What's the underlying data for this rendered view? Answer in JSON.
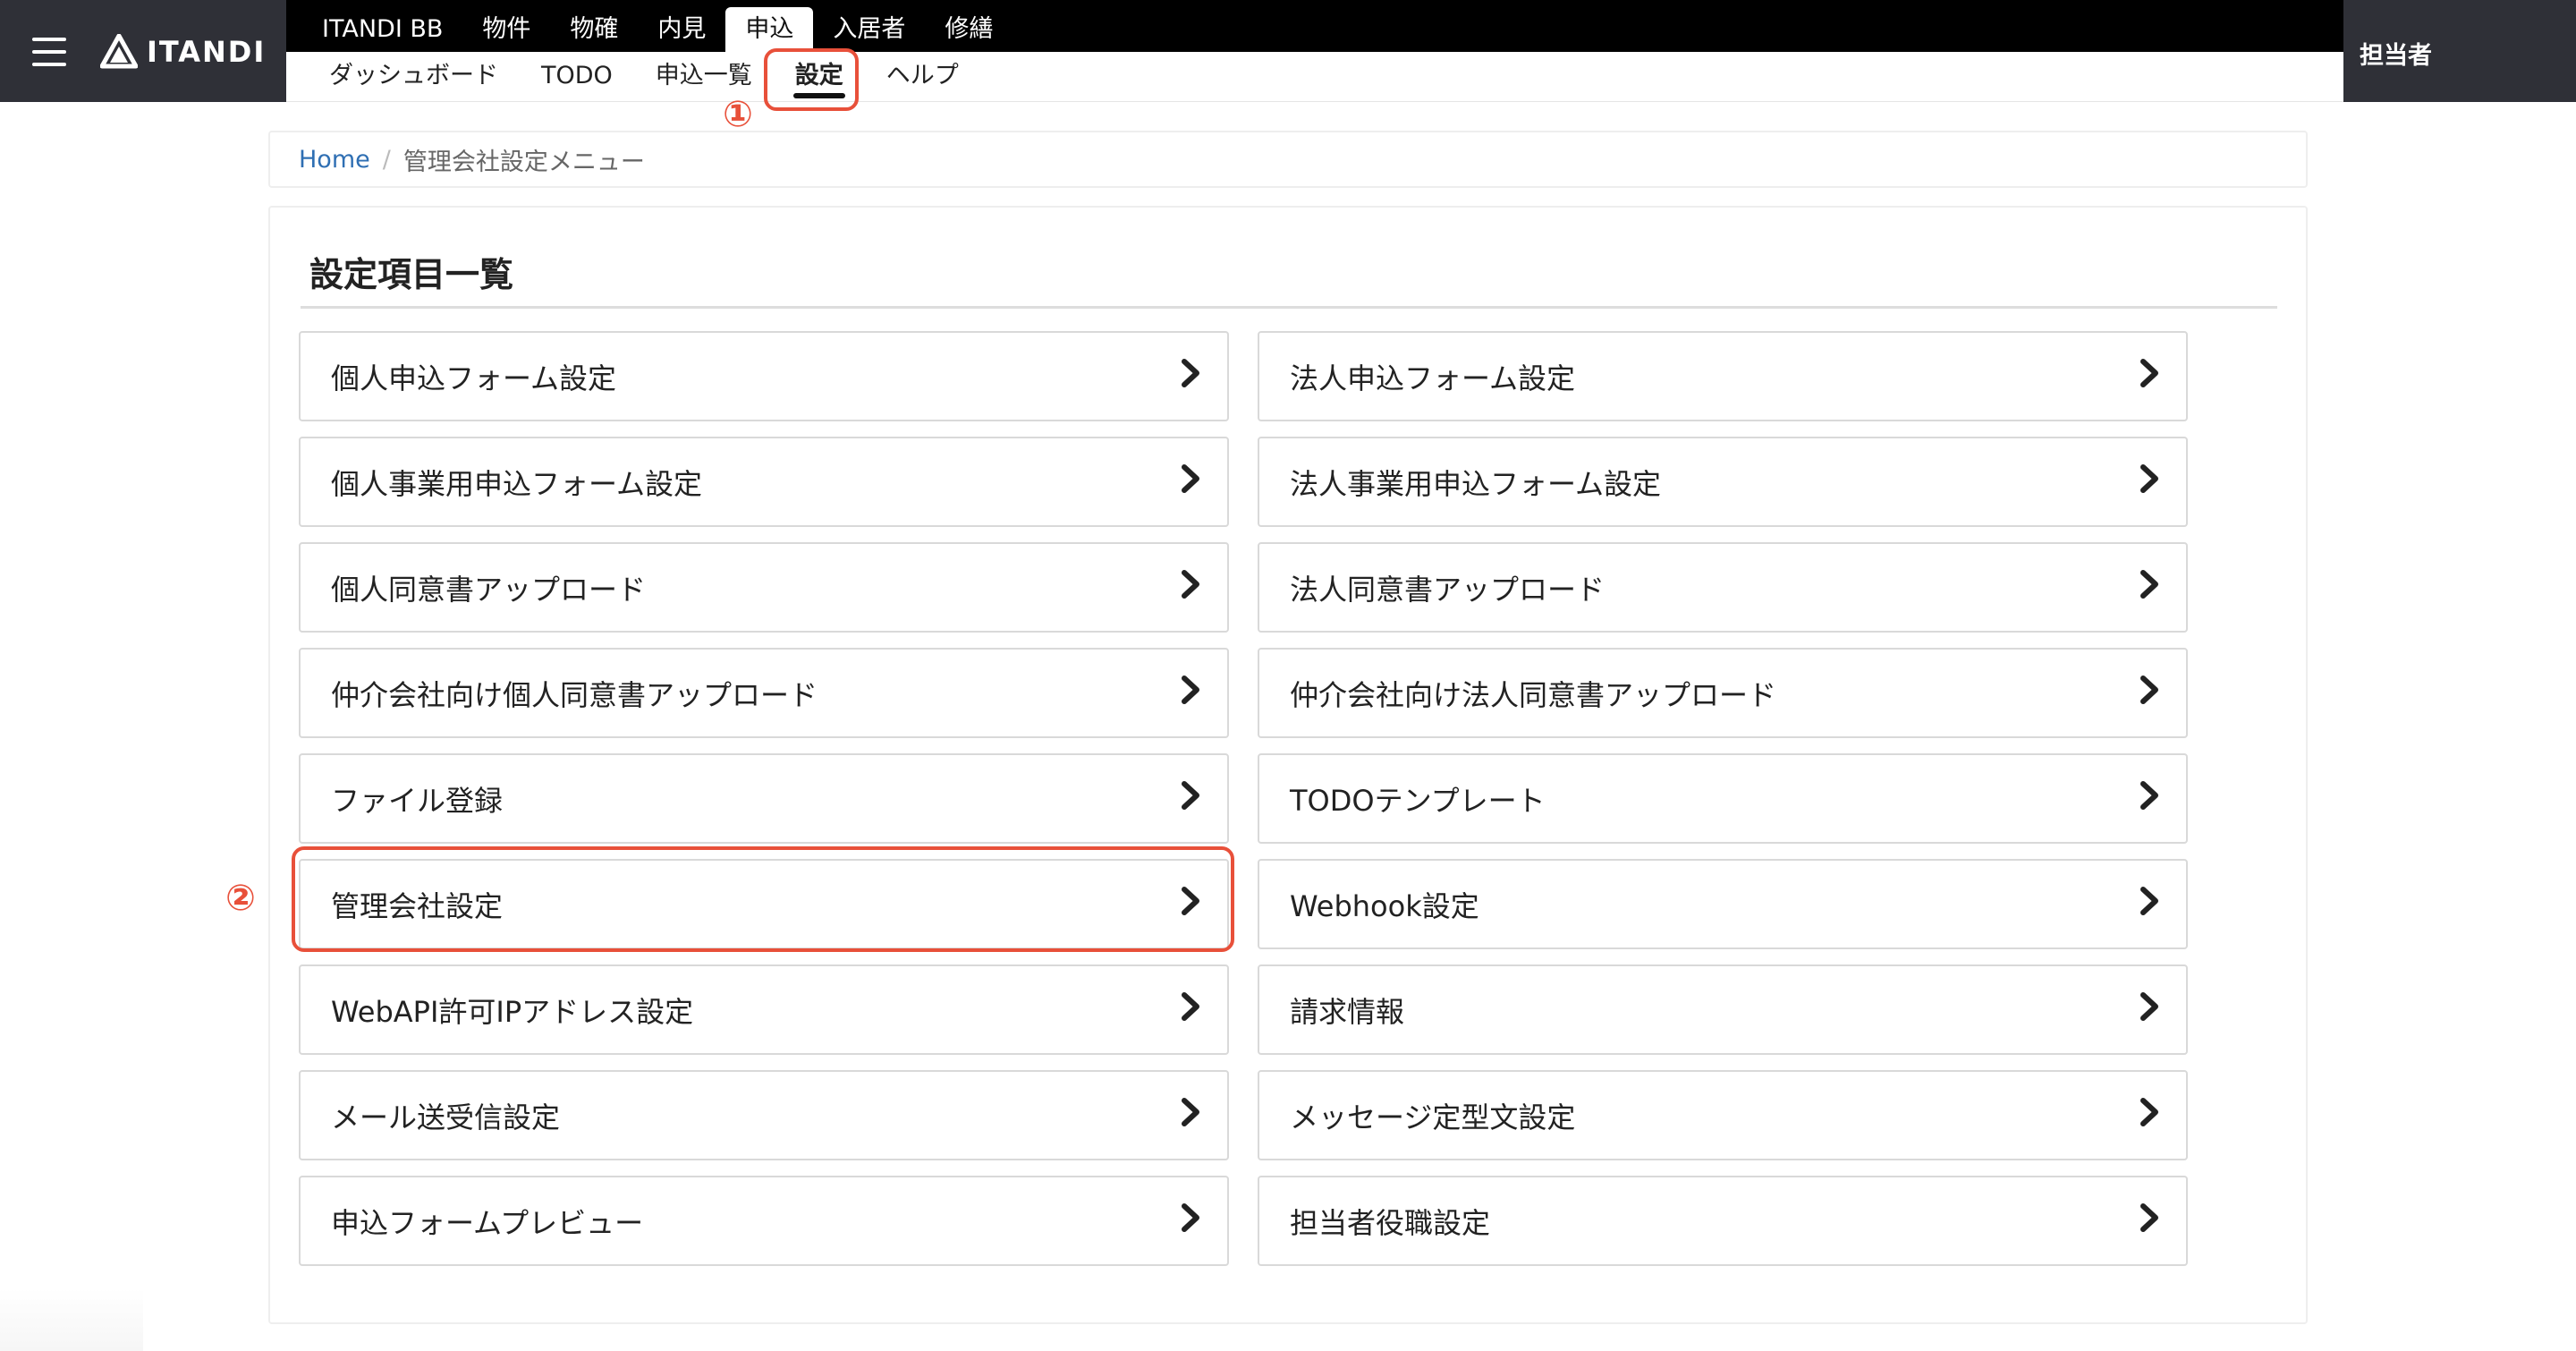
{
  "brand": {
    "logo_text": "ITANDI"
  },
  "nav_main": [
    {
      "label": "ITANDI BB"
    },
    {
      "label": "物件"
    },
    {
      "label": "物確"
    },
    {
      "label": "内見"
    },
    {
      "label": "申込",
      "active": true
    },
    {
      "label": "入居者"
    },
    {
      "label": "修繕"
    }
  ],
  "nav_sub": [
    {
      "label": "ダッシュボード"
    },
    {
      "label": "TODO"
    },
    {
      "label": "申込一覧"
    },
    {
      "label": "設定",
      "active": true
    },
    {
      "label": "ヘルプ"
    }
  ],
  "user": {
    "label": "担当者"
  },
  "annotations": {
    "step1": "①",
    "step2": "②",
    "color": "#e8503a"
  },
  "breadcrumb": {
    "home": "Home",
    "separator": "/",
    "current": "管理会社設定メニュー"
  },
  "panel": {
    "title": "設定項目一覧",
    "tiles": [
      "個人申込フォーム設定",
      "法人申込フォーム設定",
      "個人事業用申込フォーム設定",
      "法人事業用申込フォーム設定",
      "個人同意書アップロード",
      "法人同意書アップロード",
      "仲介会社向け個人同意書アップロード",
      "仲介会社向け法人同意書アップロード",
      "ファイル登録",
      "TODOテンプレート",
      "管理会社設定",
      "Webhook設定",
      "WebAPI許可IPアドレス設定",
      "請求情報",
      "メール送受信設定",
      "メッセージ定型文設定",
      "申込フォームプレビュー",
      "担当者役職設定"
    ]
  },
  "colors": {
    "header_dark": "#2f3037",
    "nav_black": "#000000",
    "link": "#2f6fb3"
  }
}
